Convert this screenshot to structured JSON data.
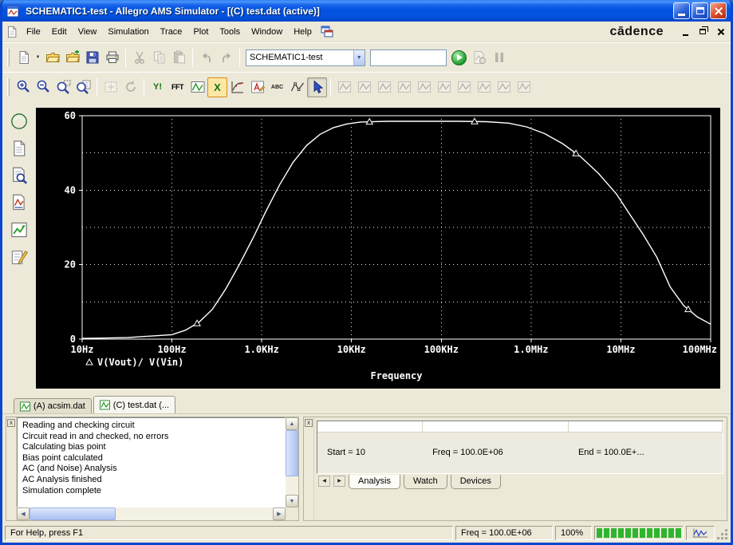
{
  "window": {
    "title": "SCHEMATIC1-test - Allegro AMS Simulator - [(C) test.dat (active)]",
    "brand": "cādence"
  },
  "menu": {
    "items": [
      "File",
      "Edit",
      "View",
      "Simulation",
      "Trace",
      "Plot",
      "Tools",
      "Window",
      "Help"
    ]
  },
  "toolbar_main": {
    "design_combo": "SCHEMATIC1-test",
    "profile_combo": ""
  },
  "toolbar_plot": {
    "y_log_label": "Y!",
    "fft_label": "FFT",
    "x_log_label": "X",
    "text_label": "ABC"
  },
  "doc_tabs": [
    {
      "label": "(A) acsim.dat",
      "active": false
    },
    {
      "label": "(C) test.dat (...",
      "active": true
    }
  ],
  "output_log": {
    "lines": [
      "Reading and checking circuit",
      "Circuit read in and checked, no errors",
      "Calculating bias point",
      "Bias point calculated",
      "AC (and Noise) Analysis",
      "AC Analysis finished",
      "Simulation complete"
    ]
  },
  "sim_panel": {
    "start": "Start = 10",
    "freq": "Freq = 100.0E+06",
    "end": "End = 100.0E+...",
    "tabs": [
      "Analysis",
      "Watch",
      "Devices"
    ]
  },
  "status_bar": {
    "help": "For Help, press F1",
    "freq": "Freq =  100.0E+06",
    "zoom": "100%"
  },
  "chart_data": {
    "type": "line",
    "title": "",
    "xlabel": "Frequency",
    "ylabel": "",
    "x_scale": "log",
    "xlog_range": [
      1,
      8
    ],
    "ylim": [
      0,
      60
    ],
    "y_grid_step": 10,
    "x_ticks": [
      "10Hz",
      "100Hz",
      "1.0KHz",
      "10KHz",
      "100KHz",
      "1.0MHz",
      "10MHz",
      "100MHz"
    ],
    "y_ticks": [
      {
        "value": 0,
        "label": "0"
      },
      {
        "value": 20,
        "label": "20"
      },
      {
        "value": 40,
        "label": "40"
      },
      {
        "value": 60,
        "label": "60"
      }
    ],
    "background": "#000000",
    "grid_color": "#ffffff",
    "legend_position": "bottom-left",
    "series": [
      {
        "name": "V(Vout)/ V(Vin)",
        "color": "#ffffff",
        "marker": "triangle",
        "points_xlog_y": [
          [
            1,
            0.2
          ],
          [
            1.5,
            0.4
          ],
          [
            2,
            1.2
          ],
          [
            2.15,
            2.4
          ],
          [
            2.3,
            4.5
          ],
          [
            2.45,
            8
          ],
          [
            2.6,
            13.5
          ],
          [
            2.75,
            20
          ],
          [
            2.9,
            27
          ],
          [
            3.05,
            34.5
          ],
          [
            3.2,
            41.5
          ],
          [
            3.35,
            47.5
          ],
          [
            3.5,
            52
          ],
          [
            3.65,
            55
          ],
          [
            3.8,
            56.8
          ],
          [
            3.95,
            57.8
          ],
          [
            4.1,
            58.3
          ],
          [
            4.4,
            58.5
          ],
          [
            4.8,
            58.5
          ],
          [
            5.2,
            58.5
          ],
          [
            5.5,
            58.4
          ],
          [
            5.75,
            58
          ],
          [
            5.95,
            57
          ],
          [
            6.15,
            55.2
          ],
          [
            6.35,
            52.5
          ],
          [
            6.55,
            49
          ],
          [
            6.75,
            44.5
          ],
          [
            6.95,
            39
          ],
          [
            7.1,
            33.5
          ],
          [
            7.25,
            28
          ],
          [
            7.4,
            22
          ],
          [
            7.55,
            14
          ],
          [
            7.7,
            9
          ],
          [
            7.85,
            6
          ],
          [
            8,
            4
          ]
        ],
        "marker_xlog": [
          2.28,
          4.2,
          5.37,
          6.5,
          7.75
        ]
      }
    ]
  }
}
